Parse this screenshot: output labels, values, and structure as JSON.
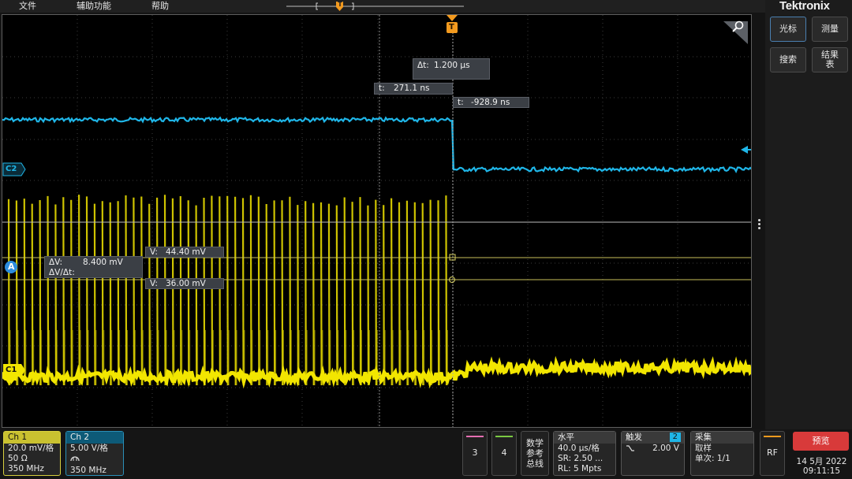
{
  "menu": {
    "items": [
      {
        "label": "文件"
      },
      {
        "label": "辅助功能"
      },
      {
        "label": "帮助"
      }
    ]
  },
  "trigger_marker": {
    "label": "T"
  },
  "brand": {
    "logo": "Tektronix"
  },
  "side_buttons": {
    "cursor": "光标",
    "measure": "测量",
    "search": "搜索",
    "results_line1": "结果",
    "results_line2": "表"
  },
  "plot": {
    "channel_labels": {
      "c1": "C1",
      "c2": "C2",
      "cursor_source": "A"
    },
    "delta_t": {
      "label": "Δt:",
      "value": "1.200 μs"
    },
    "cursor_a_time": {
      "label": "t:",
      "value": "271.1 ns"
    },
    "cursor_b_time": {
      "label": "t:",
      "value": "-928.9 ns"
    },
    "delta_v": {
      "label": "ΔV:",
      "value": "8.400 mV",
      "slope_label": "ΔV/Δt:"
    },
    "cursor_a_volt": {
      "label": "V:",
      "value": "44.40 mV"
    },
    "cursor_b_volt": {
      "label": "V:",
      "value": "36.00 mV"
    },
    "colors": {
      "ch1": "#f2e600",
      "ch2": "#1fb6e8",
      "cursor": "#d8d07a",
      "trigger": "#f39a1e"
    }
  },
  "channels": {
    "ch1": {
      "name": "Ch 1",
      "scale": "20.0 mV/格",
      "impedance": "50 Ω",
      "bandwidth": "350 MHz"
    },
    "ch2": {
      "name": "Ch 2",
      "scale": "5.00 V/格",
      "bandwidth": "350 MHz"
    }
  },
  "quick_buttons": {
    "ch3": "3",
    "ch4": "4",
    "math_line1": "数学",
    "math_line2": "参考",
    "math_line3": "总线"
  },
  "horizontal": {
    "title": "水平",
    "scale": "40.0 μs/格",
    "sample_rate": "SR: 2.50 ...",
    "record_length": "RL: 5 Mpts"
  },
  "trigger": {
    "title": "触发",
    "source": "2",
    "level": "2.00 V"
  },
  "acquisition": {
    "title": "采集",
    "mode": "取样",
    "single": "单次: 1/1"
  },
  "rf": {
    "label": "RF"
  },
  "preview": {
    "label": "预览"
  },
  "datetime": {
    "date": "14 5月 2022",
    "time": "09:11:15"
  }
}
